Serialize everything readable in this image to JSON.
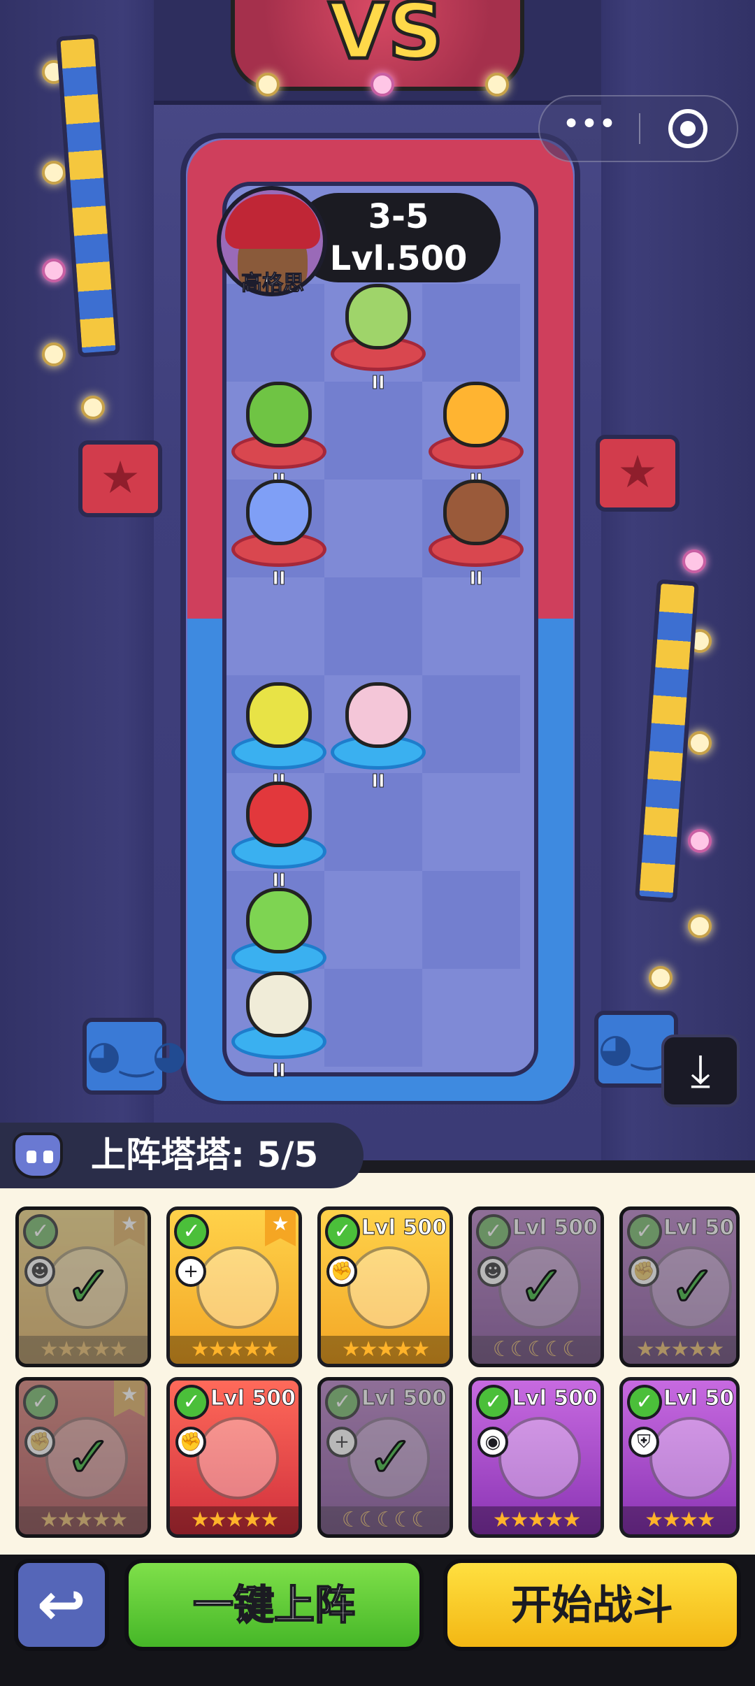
{
  "header": {
    "stage": "3-5",
    "level": "Lvl.500",
    "player_name": "高格思"
  },
  "capsule_menu": {
    "more_label": "•••"
  },
  "arena": {
    "enemy_units": [
      {
        "name": "dragonfruit-cat",
        "tier": "II"
      },
      {
        "name": "cactus-flower",
        "tier": "II"
      },
      {
        "name": "sunflower-lion",
        "tier": "II"
      },
      {
        "name": "blue-chameleon",
        "tier": "II"
      },
      {
        "name": "horned-bear",
        "tier": "II"
      }
    ],
    "ally_units": [
      {
        "name": "yellow-birds",
        "tier": "II"
      },
      {
        "name": "pink-mantis",
        "tier": "II"
      },
      {
        "name": "red-flower-plant",
        "tier": "II"
      },
      {
        "name": "green-cactus",
        "tier": "II"
      },
      {
        "name": "nest-bird",
        "tier": "II"
      }
    ]
  },
  "deploy": {
    "label": "上阵塔塔: 5/5"
  },
  "roster": {
    "row1": [
      {
        "name": "pink-mantis",
        "lvl": "",
        "color": "#f3a625",
        "state": "deployed",
        "stars": "★★★★★",
        "flag": "★"
      },
      {
        "name": "sunflower-lion",
        "lvl": "",
        "color": "#f3a625",
        "state": "available",
        "stars": "★★★★★",
        "flag": "★"
      },
      {
        "name": "panda",
        "lvl": "Lvl 500",
        "color": "#f3a625",
        "state": "available",
        "stars": "★★★★★",
        "flag": ""
      },
      {
        "name": "yellow-birds",
        "lvl": "Lvl 500",
        "color": "#8a34b4",
        "state": "deployed",
        "stars": "☾☾☾☾☾",
        "flag": ""
      },
      {
        "name": "green-cactus",
        "lvl": "Lvl 50",
        "color": "#8a34b4",
        "state": "deployed",
        "stars": "★★★★★",
        "flag": ""
      }
    ],
    "row2": [
      {
        "name": "red-flower-plant",
        "lvl": "",
        "color": "#d02f3c",
        "state": "deployed",
        "stars": "★★★★★",
        "flag": "★"
      },
      {
        "name": "frog-mushroom",
        "lvl": "Lvl 500",
        "color": "#d02f3c",
        "state": "available",
        "stars": "★★★★★",
        "flag": ""
      },
      {
        "name": "nest-bird",
        "lvl": "Lvl 500",
        "color": "#8a34b4",
        "state": "deployed",
        "stars": "☾☾☾☾☾",
        "flag": ""
      },
      {
        "name": "green-parrot",
        "lvl": "Lvl 500",
        "color": "#8a34b4",
        "state": "available",
        "stars": "★★★★★",
        "flag": ""
      },
      {
        "name": "water-blob",
        "lvl": "Lvl 50",
        "color": "#8a34b4",
        "state": "available",
        "stars": "★★★★",
        "flag": ""
      }
    ]
  },
  "actions": {
    "quick_deploy": "一键上阵",
    "start_battle": "开始战斗",
    "back_icon": "↩"
  },
  "colors": {
    "enemy_side": "#cf3f5c",
    "ally_side": "#3e8ae0",
    "quick_deploy": "#46b728",
    "start_battle": "#f3b714"
  }
}
